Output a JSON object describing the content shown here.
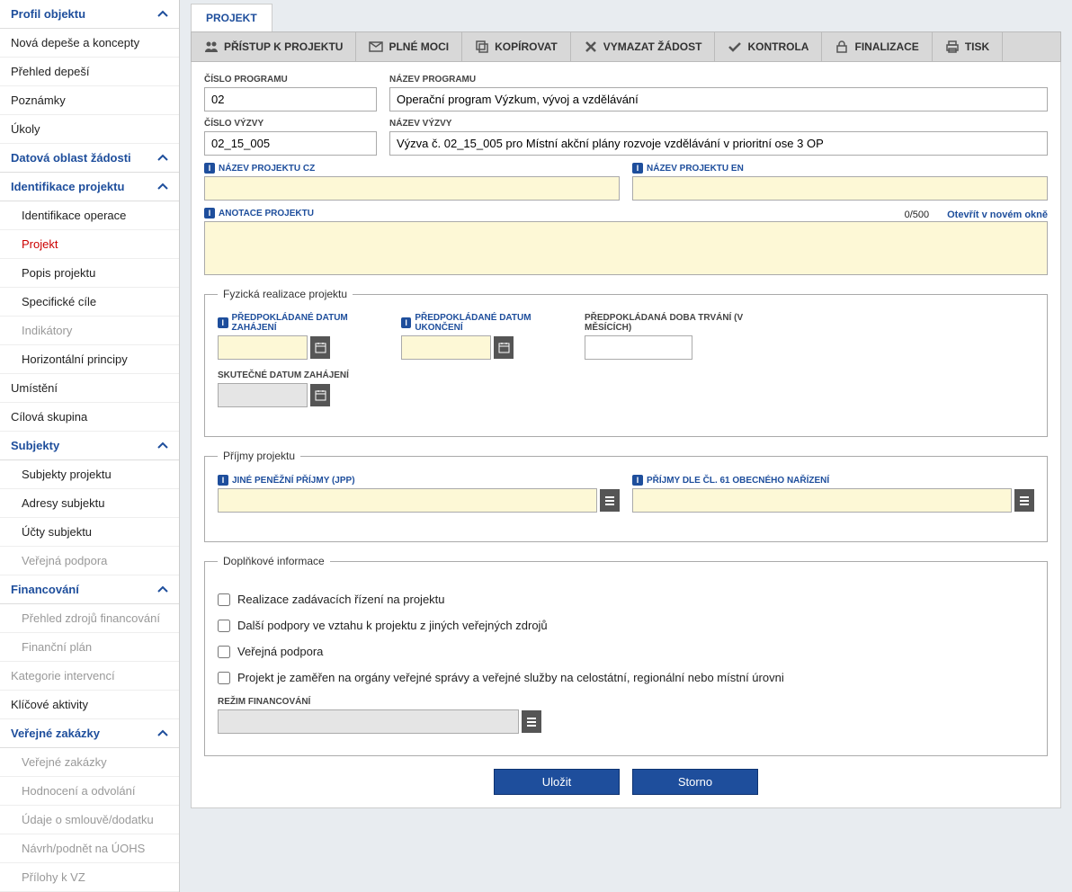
{
  "sidebar": {
    "sections": [
      {
        "header": "Profil objektu",
        "items": [
          {
            "label": "Nová depeše a koncepty"
          },
          {
            "label": "Přehled depeší"
          },
          {
            "label": "Poznámky"
          },
          {
            "label": "Úkoly"
          }
        ]
      },
      {
        "header": "Datová oblast žádosti"
      },
      {
        "header": "Identifikace projektu",
        "items": [
          {
            "label": "Identifikace operace"
          },
          {
            "label": "Projekt",
            "active": true
          },
          {
            "label": "Popis projektu"
          },
          {
            "label": "Specifické cíle"
          },
          {
            "label": "Indikátory",
            "disabled": true
          },
          {
            "label": "Horizontální principy"
          }
        ]
      },
      {
        "plain": [
          {
            "label": "Umístění"
          },
          {
            "label": "Cílová skupina"
          }
        ]
      },
      {
        "header": "Subjekty",
        "items": [
          {
            "label": "Subjekty projektu"
          },
          {
            "label": "Adresy subjektu"
          },
          {
            "label": "Účty subjektu"
          },
          {
            "label": "Veřejná podpora",
            "disabled": true
          }
        ]
      },
      {
        "header": "Financování",
        "items": [
          {
            "label": "Přehled zdrojů financování",
            "disabled": true
          },
          {
            "label": "Finanční plán",
            "disabled": true
          }
        ]
      },
      {
        "plain": [
          {
            "label": "Kategorie intervencí",
            "disabled": true
          },
          {
            "label": "Klíčové aktivity"
          }
        ]
      },
      {
        "header": "Veřejné zakázky",
        "items": [
          {
            "label": "Veřejné zakázky",
            "disabled": true
          },
          {
            "label": "Hodnocení a odvolání",
            "disabled": true
          },
          {
            "label": "Údaje o smlouvě/dodatku",
            "disabled": true
          },
          {
            "label": "Návrh/podnět na ÚOHS",
            "disabled": true
          },
          {
            "label": "Přílohy k VZ",
            "disabled": true
          }
        ]
      }
    ]
  },
  "tab": "PROJEKT",
  "toolbar": [
    {
      "label": "PŘÍSTUP K PROJEKTU",
      "icon": "users"
    },
    {
      "label": "PLNÉ MOCI",
      "icon": "mail"
    },
    {
      "label": "KOPÍROVAT",
      "icon": "copy"
    },
    {
      "label": "VYMAZAT ŽÁDOST",
      "icon": "delete"
    },
    {
      "label": "KONTROLA",
      "icon": "check"
    },
    {
      "label": "FINALIZACE",
      "icon": "lock"
    },
    {
      "label": "TISK",
      "icon": "print"
    }
  ],
  "fields": {
    "program_num_label": "ČÍSLO PROGRAMU",
    "program_num": "02",
    "program_name_label": "NÁZEV PROGRAMU",
    "program_name": "Operační program Výzkum, vývoj a vzdělávání",
    "call_num_label": "ČÍSLO VÝZVY",
    "call_num": "02_15_005",
    "call_name_label": "NÁZEV VÝZVY",
    "call_name": "Výzva č. 02_15_005 pro Místní akční plány rozvoje vzdělávání v prioritní ose 3 OP",
    "name_cz_label": "NÁZEV PROJEKTU CZ",
    "name_cz": "",
    "name_en_label": "NÁZEV PROJEKTU EN",
    "name_en": "",
    "annotation_label": "ANOTACE PROJEKTU",
    "annotation": "",
    "counter": "0/500",
    "open_new": "Otevřít v novém okně"
  },
  "physical": {
    "legend": "Fyzická realizace projektu",
    "start_label": "PŘEDPOKLÁDANÉ DATUM ZAHÁJENÍ",
    "end_label": "PŘEDPOKLÁDANÉ DATUM UKONČENÍ",
    "duration_label": "PŘEDPOKLÁDANÁ DOBA TRVÁNÍ (V MĚSÍCÍCH)",
    "actual_start_label": "SKUTEČNÉ DATUM ZAHÁJENÍ"
  },
  "income": {
    "legend": "Příjmy projektu",
    "jpp_label": "JINÉ PENĚŽNÍ PŘÍJMY (JPP)",
    "cl61_label": "PŘÍJMY DLE ČL. 61 OBECNÉHO NAŘÍZENÍ"
  },
  "additional": {
    "legend": "Doplňkové informace",
    "c1": "Realizace zadávacích řízení na projektu",
    "c2": "Další podpory ve vztahu k projektu z jiných veřejných zdrojů",
    "c3": "Veřejná podpora",
    "c4": "Projekt je zaměřen na orgány veřejné správy a veřejné služby na celostátní, regionální nebo místní úrovni",
    "regime_label": "REŽIM FINANCOVÁNÍ"
  },
  "buttons": {
    "save": "Uložit",
    "cancel": "Storno"
  }
}
